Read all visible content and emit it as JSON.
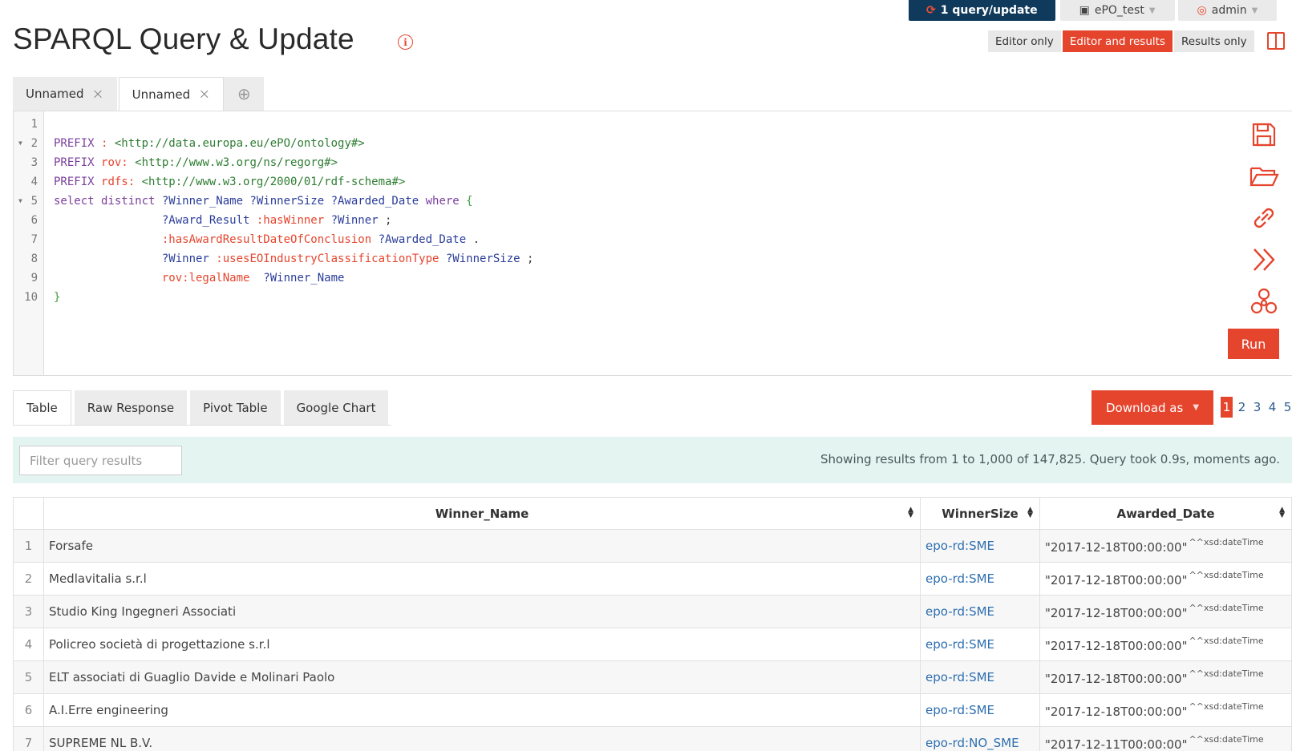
{
  "topbar": {
    "query_btn": "1 query/update",
    "repo_btn": "ePO_test",
    "user_btn": "admin"
  },
  "page": {
    "title": "SPARQL Query & Update",
    "info": "i"
  },
  "view_modes": [
    "Editor only",
    "Editor and results",
    "Results only"
  ],
  "editor_tabs": [
    {
      "label": "Unnamed",
      "close": "×"
    },
    {
      "label": "Unnamed",
      "close": "×"
    }
  ],
  "editor_add": "⊕",
  "run_label": "Run",
  "result_tabs": [
    "Table",
    "Raw Response",
    "Pivot Table",
    "Google Chart"
  ],
  "download_label": "Download as",
  "pages": [
    "1",
    "2",
    "3",
    "4",
    "5"
  ],
  "filter_placeholder": "Filter query results",
  "status": "Showing results from 1 to 1,000 of 147,825. Query took 0.9s, moments ago.",
  "table": {
    "columns": [
      "Winner_Name",
      "WinnerSize",
      "Awarded_Date"
    ],
    "rows": [
      {
        "i": "1",
        "name": "Forsafe",
        "size": "epo-rd:SME",
        "date": "\"2017-12-18T00:00:00\"",
        "type": "^^xsd:dateTime"
      },
      {
        "i": "2",
        "name": "Medlavitalia s.r.l",
        "size": "epo-rd:SME",
        "date": "\"2017-12-18T00:00:00\"",
        "type": "^^xsd:dateTime"
      },
      {
        "i": "3",
        "name": "Studio King Ingegneri Associati",
        "size": "epo-rd:SME",
        "date": "\"2017-12-18T00:00:00\"",
        "type": "^^xsd:dateTime"
      },
      {
        "i": "4",
        "name": "Policreo società di progettazione s.r.l",
        "size": "epo-rd:SME",
        "date": "\"2017-12-18T00:00:00\"",
        "type": "^^xsd:dateTime"
      },
      {
        "i": "5",
        "name": "ELT associati di Guaglio Davide e Molinari Paolo",
        "size": "epo-rd:SME",
        "date": "\"2017-12-18T00:00:00\"",
        "type": "^^xsd:dateTime"
      },
      {
        "i": "6",
        "name": "A.I.Erre engineering",
        "size": "epo-rd:SME",
        "date": "\"2017-12-18T00:00:00\"",
        "type": "^^xsd:dateTime"
      },
      {
        "i": "7",
        "name": "SUPREME NL B.V.",
        "size": "epo-rd:NO_SME",
        "date": "\"2017-12-11T00:00:00\"",
        "type": "^^xsd:dateTime"
      }
    ]
  },
  "code_lines": [
    {
      "n": "1",
      "fold": "",
      "tokens": []
    },
    {
      "n": "2",
      "fold": "▼",
      "tokens": [
        [
          "kw",
          "PREFIX "
        ],
        [
          "pfx",
          ": "
        ],
        [
          "iri",
          "<http://data.europa.eu/ePO/ontology#>"
        ]
      ]
    },
    {
      "n": "3",
      "fold": "",
      "tokens": [
        [
          "kw",
          "PREFIX "
        ],
        [
          "pfx",
          "rov: "
        ],
        [
          "iri",
          "<http://www.w3.org/ns/regorg#>"
        ]
      ]
    },
    {
      "n": "4",
      "fold": "",
      "tokens": [
        [
          "kw",
          "PREFIX "
        ],
        [
          "pfx",
          "rdfs: "
        ],
        [
          "iri",
          "<http://www.w3.org/2000/01/rdf-schema#>"
        ]
      ]
    },
    {
      "n": "5",
      "fold": "▼",
      "tokens": [
        [
          "kw",
          "select distinct "
        ],
        [
          "var",
          "?Winner_Name ?WinnerSize ?Awarded_Date "
        ],
        [
          "kw",
          "where "
        ],
        [
          "br",
          "{"
        ]
      ]
    },
    {
      "n": "6",
      "fold": "",
      "tokens": [
        [
          "pun",
          "                "
        ],
        [
          "var",
          "?Award_Result "
        ],
        [
          "pfx",
          ":hasWinner "
        ],
        [
          "var",
          "?Winner "
        ],
        [
          "pun",
          ";"
        ]
      ]
    },
    {
      "n": "7",
      "fold": "",
      "tokens": [
        [
          "pun",
          "                "
        ],
        [
          "pfx",
          ":hasAwardResultDateOfConclusion "
        ],
        [
          "var",
          "?Awarded_Date "
        ],
        [
          "pun",
          "."
        ]
      ]
    },
    {
      "n": "8",
      "fold": "",
      "tokens": [
        [
          "pun",
          "                "
        ],
        [
          "var",
          "?Winner "
        ],
        [
          "pfx",
          ":usesEOIndustryClassificationType "
        ],
        [
          "var",
          "?WinnerSize "
        ],
        [
          "pun",
          ";"
        ]
      ]
    },
    {
      "n": "9",
      "fold": "",
      "tokens": [
        [
          "pun",
          "                "
        ],
        [
          "pfx",
          "rov:legalName  "
        ],
        [
          "var",
          "?Winner_Name"
        ]
      ]
    },
    {
      "n": "10",
      "fold": "",
      "tokens": [
        [
          "br",
          "}"
        ]
      ]
    }
  ]
}
